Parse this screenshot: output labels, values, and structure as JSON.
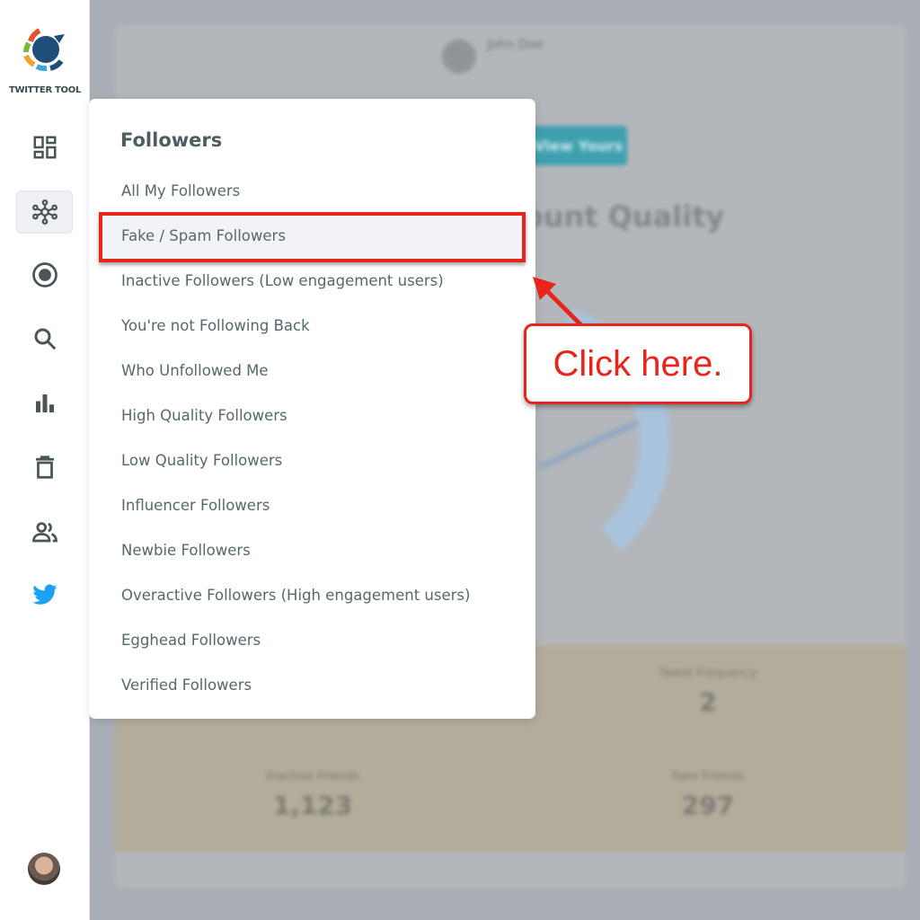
{
  "app": {
    "name": "TWITTER TOOL"
  },
  "sidebar": {
    "items": [
      {
        "icon": "dashboard-icon",
        "active": false
      },
      {
        "icon": "network-icon",
        "active": true
      },
      {
        "icon": "record-icon",
        "active": false
      },
      {
        "icon": "search-icon",
        "active": false
      },
      {
        "icon": "bar-chart-icon",
        "active": false
      },
      {
        "icon": "trash-icon",
        "active": false
      },
      {
        "icon": "people-icon",
        "active": false
      },
      {
        "icon": "twitter-bird-icon",
        "active": false
      }
    ]
  },
  "background": {
    "user_name": "John Doe",
    "button_label": "View Yours",
    "title": "Account Quality",
    "stats": [
      {
        "label": "Tweet Frequency",
        "value": "2"
      },
      {
        "label": "Inactive Friends",
        "value": "1,123"
      },
      {
        "label": "Fake Friends",
        "value": "297"
      }
    ]
  },
  "menu": {
    "title": "Followers",
    "items": [
      "All My Followers",
      "Fake / Spam Followers",
      "Inactive Followers (Low engagement users)",
      "You're not Following Back",
      "Who Unfollowed Me",
      "High Quality Followers",
      "Low Quality Followers",
      "Influencer Followers",
      "Newbie Followers",
      "Overactive Followers (High engagement users)",
      "Egghead Followers",
      "Verified Followers"
    ],
    "highlighted_index": 1
  },
  "annotation": {
    "text": "Click here.",
    "color": "#e8241c"
  },
  "colors": {
    "accent": "#3ea0ae",
    "twitter": "#1da1f2",
    "highlight": "#e8241c"
  }
}
